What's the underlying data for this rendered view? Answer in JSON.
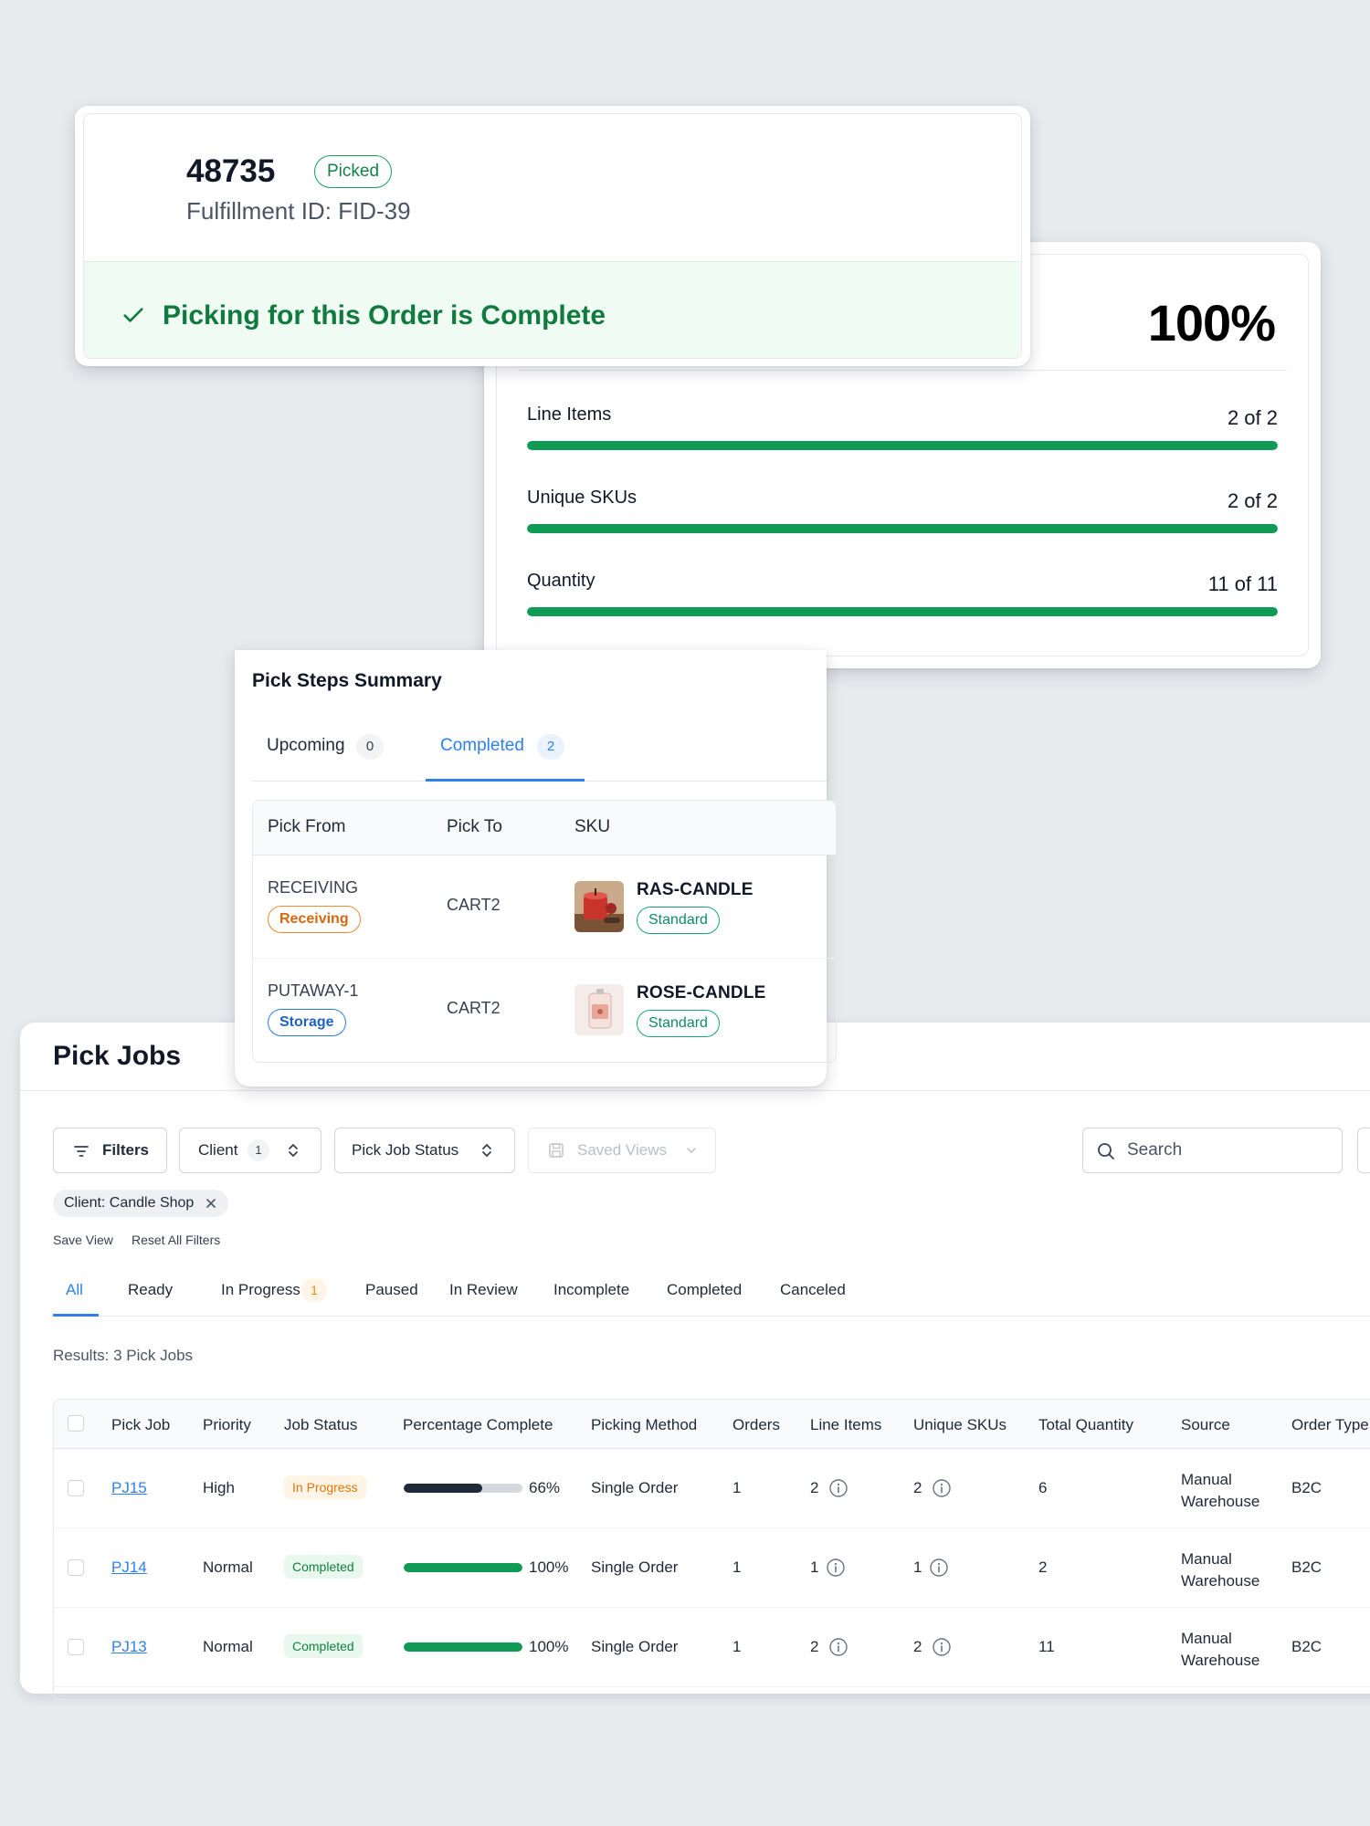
{
  "progress": {
    "percent_label": "100%",
    "metrics": [
      {
        "label": "Line Items",
        "value": "2 of 2",
        "fraction": 1.0
      },
      {
        "label": "Unique SKUs",
        "value": "2 of 2",
        "fraction": 1.0
      },
      {
        "label": "Quantity",
        "value": "11 of 11",
        "fraction": 1.0
      }
    ],
    "accent_color": "#0f9a55"
  },
  "order": {
    "number": "48735",
    "status_badge": "Picked",
    "fulfillment_id": "Fulfillment ID: FID-39",
    "banner_message": "Picking for this Order is Complete",
    "banner_icon": "check-icon"
  },
  "pick_steps": {
    "title": "Pick Steps Summary",
    "tabs": [
      {
        "label": "Upcoming",
        "count": "0"
      },
      {
        "label": "Completed",
        "count": "2"
      }
    ],
    "columns": [
      "Pick From",
      "Pick To",
      "SKU"
    ],
    "rows": [
      {
        "from": "RECEIVING",
        "from_tag": "Receiving",
        "to": "CART2",
        "sku": "RAS-CANDLE",
        "sku_tag": "Standard",
        "thumb": "red-candle-thumbnail"
      },
      {
        "from": "PUTAWAY-1",
        "from_tag": "Storage",
        "to": "CART2",
        "sku": "ROSE-CANDLE",
        "sku_tag": "Standard",
        "thumb": "rose-candle-thumbnail"
      }
    ]
  },
  "pick_jobs": {
    "title": "Pick Jobs",
    "toolbar": {
      "filters_label": "Filters",
      "client_label": "Client",
      "client_count": "1",
      "status_label": "Pick Job Status",
      "saved_views_label": "Saved Views",
      "search_placeholder": "Search"
    },
    "active_filter_chip": "Client: Candle Shop",
    "save_view_label": "Save View",
    "reset_filters_label": "Reset All Filters",
    "status_tabs": [
      {
        "label": "All",
        "active": true
      },
      {
        "label": "Ready"
      },
      {
        "label": "In Progress",
        "count": "1"
      },
      {
        "label": "Paused"
      },
      {
        "label": "In Review"
      },
      {
        "label": "Incomplete"
      },
      {
        "label": "Completed"
      },
      {
        "label": "Canceled"
      }
    ],
    "results_text": "Results: 3 Pick Jobs",
    "columns": [
      "Pick Job",
      "Priority",
      "Job Status",
      "Percentage Complete",
      "Picking Method",
      "Orders",
      "Line Items",
      "Unique SKUs",
      "Total Quantity",
      "Source",
      "Order Type"
    ],
    "rows": [
      {
        "job": "PJ15",
        "priority": "High",
        "status": "In Progress",
        "percent": 66,
        "percent_label": "66%",
        "method": "Single Order",
        "orders": "1",
        "line_items": "2",
        "unique_skus": "2",
        "total_qty": "6",
        "source_1": "Manual",
        "source_2": "Warehouse",
        "order_type": "B2C",
        "bar_color": "#1f2937"
      },
      {
        "job": "PJ14",
        "priority": "Normal",
        "status": "Completed",
        "percent": 100,
        "percent_label": "100%",
        "method": "Single Order",
        "orders": "1",
        "line_items": "1",
        "unique_skus": "1",
        "total_qty": "2",
        "source_1": "Manual",
        "source_2": "Warehouse",
        "order_type": "B2C",
        "bar_color": "#0f9a55"
      },
      {
        "job": "PJ13",
        "priority": "Normal",
        "status": "Completed",
        "percent": 100,
        "percent_label": "100%",
        "method": "Single Order",
        "orders": "1",
        "line_items": "2",
        "unique_skus": "2",
        "total_qty": "11",
        "source_1": "Manual",
        "source_2": "Warehouse",
        "order_type": "B2C",
        "bar_color": "#0f9a55"
      }
    ]
  }
}
